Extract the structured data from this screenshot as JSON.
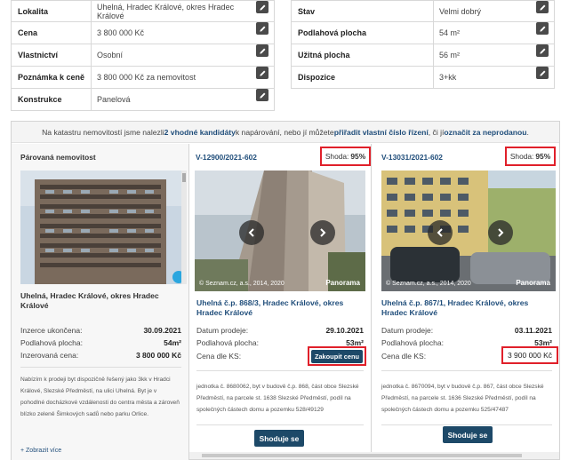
{
  "left_props": [
    {
      "label": "Lokalita",
      "value": "Uhelná, Hradec Králové, okres Hradec Králové"
    },
    {
      "label": "Cena",
      "value": "3 800 000 Kč"
    },
    {
      "label": "Vlastnictví",
      "value": "Osobní"
    },
    {
      "label": "Poznámka k ceně",
      "value": "3 800 000 Kč za nemovitost"
    },
    {
      "label": "Konstrukce",
      "value": "Panelová"
    }
  ],
  "right_props": [
    {
      "label": "Stav",
      "value": "Velmi dobrý"
    },
    {
      "label": "Podlahová plocha",
      "value": "54 m²"
    },
    {
      "label": "Užitná plocha",
      "value": "56 m²"
    },
    {
      "label": "Dispozice",
      "value": "3+kk"
    }
  ],
  "notice": {
    "t1": "Na katastru nemovitostí jsme nalezli ",
    "count": "2 vhodné kandidáty",
    "t2": " k napárování, nebo jí můžete ",
    "link1": "přiřadit vlastní číslo řízení",
    "t3": ", či jí ",
    "link2": "označit za neprodanou",
    "t4": "."
  },
  "paired": {
    "heading": "Párovaná nemovitost",
    "title": "Uhelná, Hradec Králové, okres Hradec Králové",
    "rows": [
      {
        "label": "Inzerce ukončena:",
        "value": "30.09.2021"
      },
      {
        "label": "Podlahová plocha:",
        "value": "54m²"
      },
      {
        "label": "Inzerovaná cena:",
        "value": "3 800 000 Kč"
      }
    ],
    "description": "Nabízím k prodeji byt dispozičně řešený jako 3kk v Hradci Králové, Slezské Předměstí, na ulici Uhelná. Byt je v pohodlné docházkové vzdálenosti do centra města a zároveň blízko zeleně Šimkových sadů nebo parku Orlice.",
    "more": "+ Zobrazit více"
  },
  "candidates": [
    {
      "id": "V-12900/2021-602",
      "shoda_label": "Shoda:",
      "shoda_value": "95%",
      "photo_caption": "© Seznam.cz, a.s., 2014, 2020",
      "panorama": "Panorama",
      "title": "Uhelná č.p. 868/3, Hradec Králové, okres Hradec Králové",
      "date_label": "Datum prodeje:",
      "date_value": "29.10.2021",
      "area_label": "Podlahová plocha:",
      "area_value": "53m²",
      "price_label": "Cena dle KS:",
      "buy_label": "Zakoupit cenu",
      "description": "jednotka č. 8680062, byt v budově č.p. 868, část obce Slezské Předměstí, na parcele st. 1638 Slezské Předměstí, podíl na společných částech domu a pozemku 528/49129",
      "match_label": "Shoduje se"
    },
    {
      "id": "V-13031/2021-602",
      "shoda_label": "Shoda:",
      "shoda_value": "95%",
      "photo_caption": "© Seznam.cz, a.s., 2014, 2020",
      "panorama": "Panorama",
      "title": "Uhelná č.p. 867/1, Hradec Králové, okres Hradec Králové",
      "date_label": "Datum prodeje:",
      "date_value": "03.11.2021",
      "area_label": "Podlahová plocha:",
      "area_value": "53m²",
      "price_label": "Cena dle KS:",
      "price_value": "3 900 000 Kč",
      "description": "jednotka č. 8670094, byt v budově č.p. 867, část obce Slezské Předměstí, na parcele st. 1636 Slezské Předměstí, podíl na společných částech domu a pozemku 525/47487",
      "match_label": "Shoduje se"
    }
  ],
  "colors": {
    "accent": "#1f4d7a",
    "button": "#1d4968",
    "highlight": "#e0202a"
  },
  "icons": {
    "edit": "pencil-icon",
    "prev": "chevron-left-icon",
    "next": "chevron-right-icon"
  }
}
